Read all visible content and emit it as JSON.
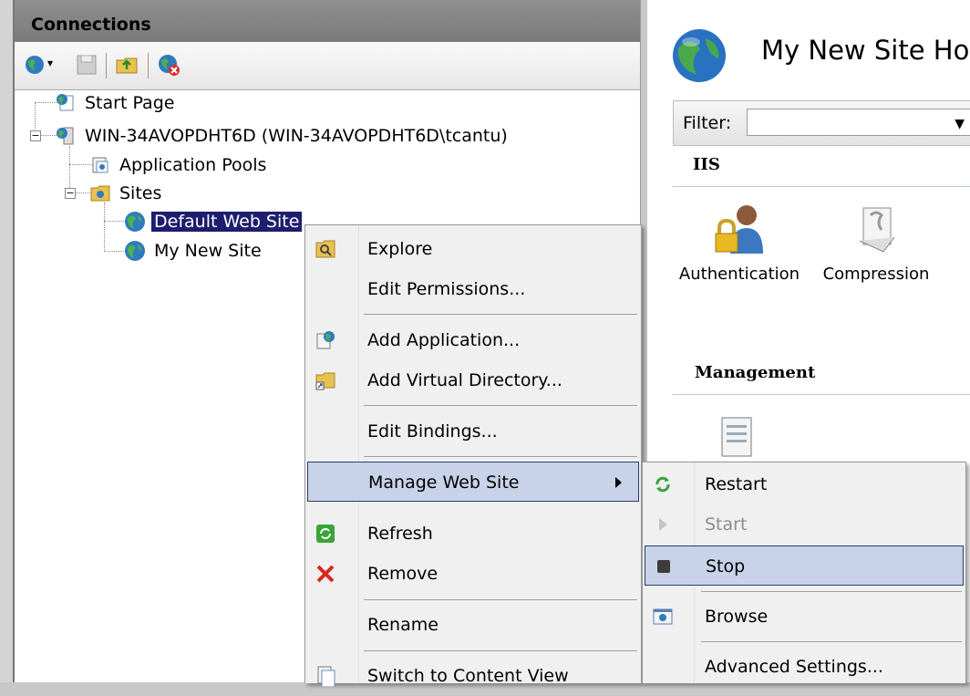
{
  "connections": {
    "title": "Connections",
    "toolbar": [
      {
        "icon": "connect-icon"
      },
      {
        "icon": "save-icon"
      },
      {
        "icon": "up-folder-icon"
      },
      {
        "icon": "disconnect-icon"
      }
    ],
    "tree": {
      "start_page": "Start Page",
      "server": "WIN-34AVOPDHT6D (WIN-34AVOPDHT6D\\tcantu)",
      "app_pools": "Application Pools",
      "sites": "Sites",
      "default_site": "Default Web Site",
      "new_site": "My New Site"
    }
  },
  "content": {
    "title": "My New Site Ho",
    "filter_label": "Filter:",
    "iis_group": "IIS",
    "features": {
      "authentication": "Authentication",
      "compression": "Compression"
    },
    "management_group": "Management"
  },
  "context_menu": {
    "explore": "Explore",
    "edit_permissions": "Edit Permissions...",
    "add_application": "Add Application...",
    "add_virtual_directory": "Add Virtual Directory...",
    "edit_bindings": "Edit Bindings...",
    "manage_web_site": "Manage Web Site",
    "refresh": "Refresh",
    "remove": "Remove",
    "rename": "Rename",
    "switch_content_view": "Switch to Content View"
  },
  "submenu": {
    "restart": "Restart",
    "start": "Start",
    "stop": "Stop",
    "browse": "Browse",
    "advanced_settings": "Advanced Settings..."
  },
  "colors": {
    "selection": "#1e1e6e",
    "menu_highlight": "#c8d2e8",
    "menu_highlight_border": "#2b3b6e"
  }
}
